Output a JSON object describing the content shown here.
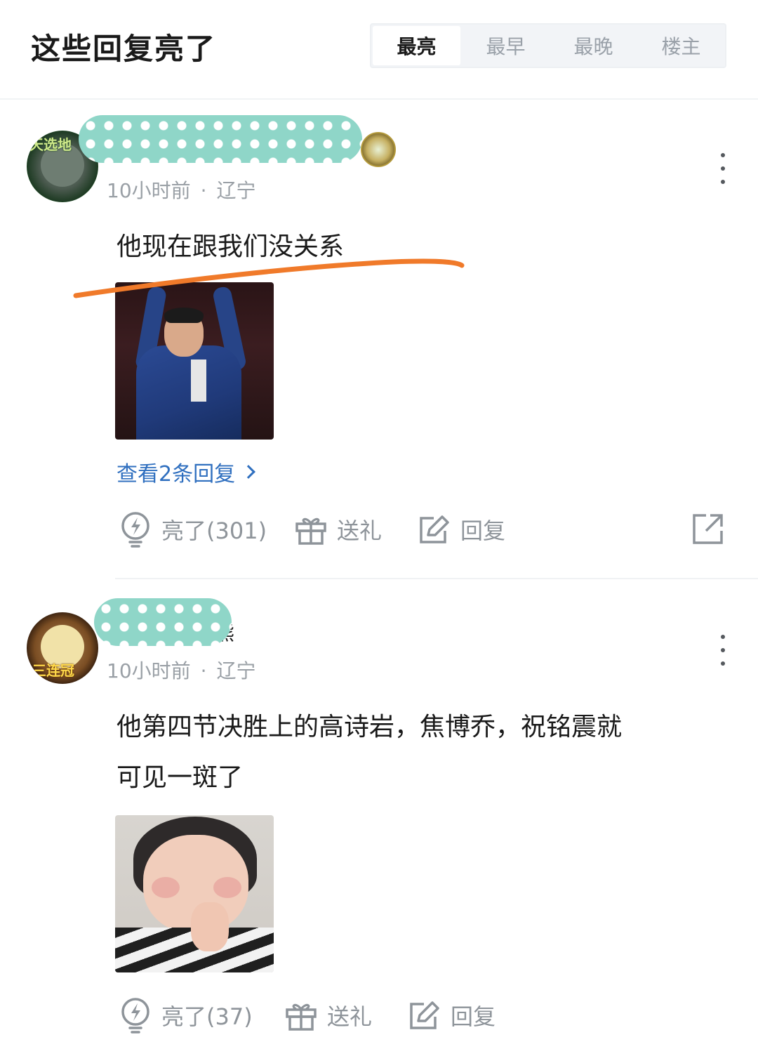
{
  "header": {
    "title": "这些回复亮了",
    "tabs": [
      {
        "label": "最亮",
        "active": true
      },
      {
        "label": "最早",
        "active": false
      },
      {
        "label": "最晚",
        "active": false
      },
      {
        "label": "楼主",
        "active": false
      }
    ]
  },
  "comments": [
    {
      "avatar_badge": "天选地",
      "username_visible": "",
      "time": "10小时前",
      "location": "辽宁",
      "text": "他现在跟我们没关系",
      "image": "coach-photo",
      "view_replies": "查看2条回复",
      "actions": {
        "like": "亮了(301)",
        "gift": "送礼",
        "reply": "回复"
      }
    },
    {
      "avatar_badge": "三连冠",
      "username_visible": "熊",
      "time": "10小时前",
      "location": "辽宁",
      "text_line1": "他第四节决胜上的高诗岩，焦博乔，祝铭震就",
      "text_line2": "可见一斑了",
      "image": "kid-photo",
      "actions": {
        "like": "亮了(37)",
        "gift": "送礼",
        "reply": "回复"
      }
    }
  ],
  "colors": {
    "accent_link": "#2f6fbf",
    "annotation_line": "#f07a2a",
    "mask": "#8fd6c8",
    "muted_text": "#9aa0a6"
  },
  "icons": {
    "like": "lightbulb-icon",
    "gift": "gift-icon",
    "reply": "edit-icon",
    "share": "share-icon",
    "more": "more-vertical-icon"
  }
}
